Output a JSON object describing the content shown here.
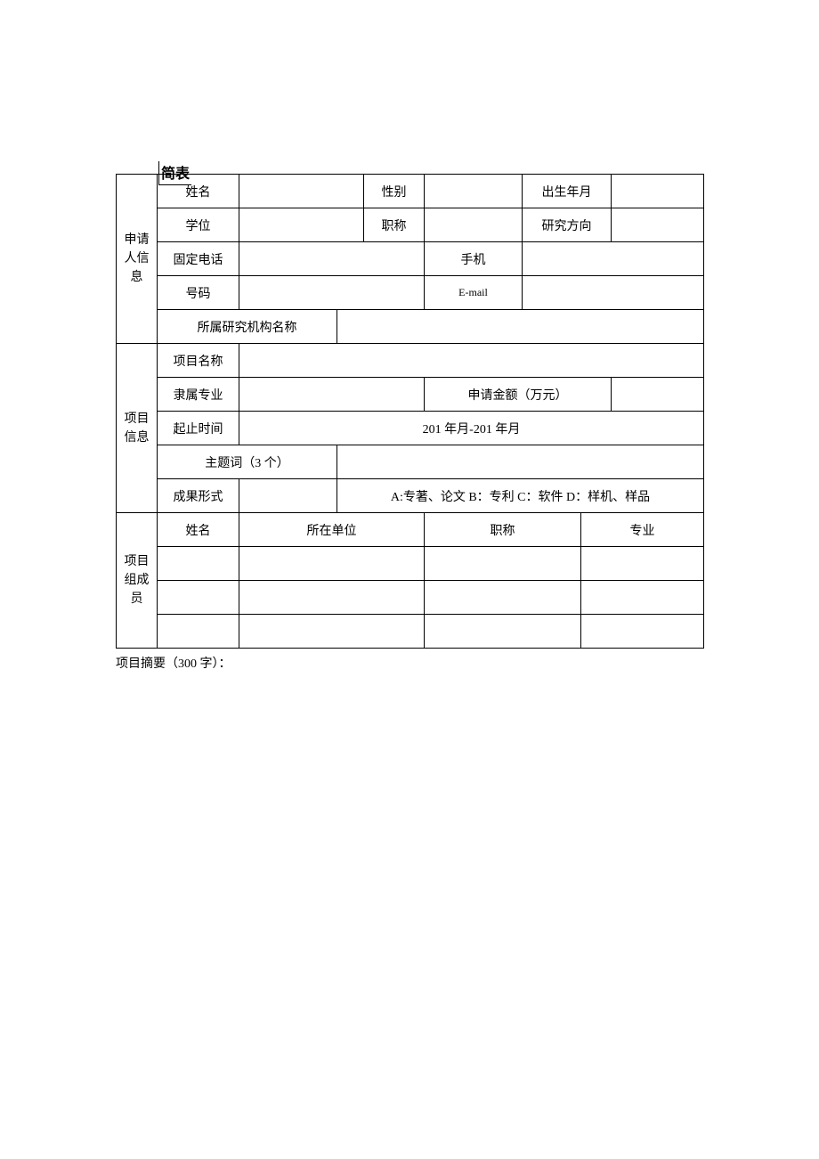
{
  "title_fragment": "简表",
  "applicant": {
    "section_label": "申请人信息",
    "labels": {
      "name": "姓名",
      "gender": "性别",
      "birth_date": "出生年月",
      "degree": "学位",
      "title": "职称",
      "research_direction": "研究方向",
      "phone_fixed": "固定电话",
      "phone_mobile": "手机",
      "number": "号码",
      "email": "E-mail",
      "institution": "所属研究机构名称"
    },
    "values": {
      "name": "",
      "gender": "",
      "birth_date": "",
      "degree": "",
      "title": "",
      "research_direction": "",
      "phone_fixed": "",
      "phone_mobile": "",
      "number": "",
      "email": "",
      "institution": ""
    }
  },
  "project": {
    "section_label": "项目信息",
    "labels": {
      "project_name": "项目名称",
      "major": "隶属专业",
      "amount": "申请金额（万元）",
      "duration": "起止时间",
      "keywords": "主题词（3 个）",
      "output_form": "成果形式"
    },
    "values": {
      "project_name": "",
      "major": "",
      "amount": "",
      "duration": "201 年月-201 年月",
      "keywords": "",
      "output_form_code": "",
      "output_form_options": "A:专著、论文 B：专利 C：软件 D：样机、样品"
    }
  },
  "members": {
    "section_label": "项目组成员",
    "headers": {
      "name": "姓名",
      "unit": "所在单位",
      "title": "职称",
      "major": "专业"
    },
    "rows": [
      {
        "name": "",
        "unit": "",
        "title": "",
        "major": ""
      },
      {
        "name": "",
        "unit": "",
        "title": "",
        "major": ""
      },
      {
        "name": "",
        "unit": "",
        "title": "",
        "major": ""
      }
    ]
  },
  "footer": {
    "abstract_label": "项目摘要（300 字）："
  }
}
